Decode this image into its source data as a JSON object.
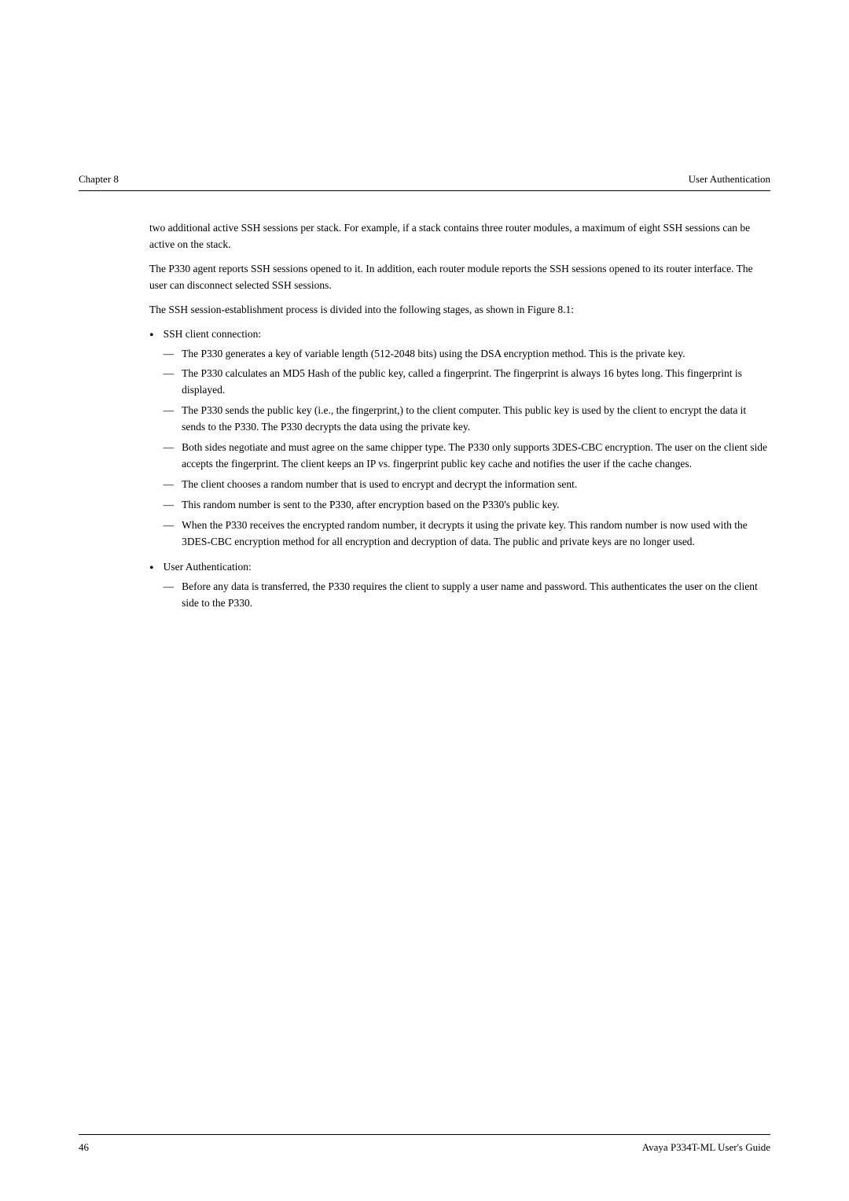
{
  "header": {
    "chapter": "Chapter 8",
    "section": "User Authentication"
  },
  "footer": {
    "page_number": "46",
    "document_title": "Avaya P334T-ML User's Guide"
  },
  "content": {
    "paragraph1": "two additional active SSH sessions per stack. For example, if a stack contains three router modules, a maximum of eight SSH sessions can be active on the stack.",
    "paragraph2": "The P330 agent reports SSH sessions opened to it. In addition, each router module reports the SSH sessions opened to its router interface. The user can disconnect selected SSH sessions.",
    "paragraph3": "The SSH session-establishment process is divided into the following stages, as shown in Figure 8.1:",
    "bullet1_label": "SSH client connection:",
    "bullet1_subitems": [
      "The P330 generates a key of variable length (512-2048 bits) using the DSA encryption method. This is the private key.",
      "The P330 calculates an MD5 Hash of the public key, called a fingerprint. The fingerprint is always 16 bytes long. This fingerprint is displayed.",
      "The P330 sends the public key (i.e., the fingerprint,) to the client computer. This public key is used by the client to encrypt the data it sends to the P330. The P330 decrypts the data using the private key.",
      "Both sides negotiate and must agree on the same chipper type. The P330 only supports 3DES-CBC encryption. The user on the client side accepts the fingerprint. The client keeps an IP vs. fingerprint public key cache and notifies the user if the cache changes.",
      "The client chooses a random number that is used to encrypt and decrypt the information sent.",
      "This random number is sent to the P330, after encryption based on the P330’s public key.",
      "When the P330 receives the encrypted random number, it decrypts it using the private key. This random number is now used with the 3DES-CBC encryption method for all encryption and decryption of data. The public and private keys are no longer used."
    ],
    "bullet2_label": "User Authentication:",
    "bullet2_subitems": [
      "Before any data is transferred, the P330 requires the client to supply a user name and password. This authenticates the user on the client side to the P330."
    ]
  }
}
